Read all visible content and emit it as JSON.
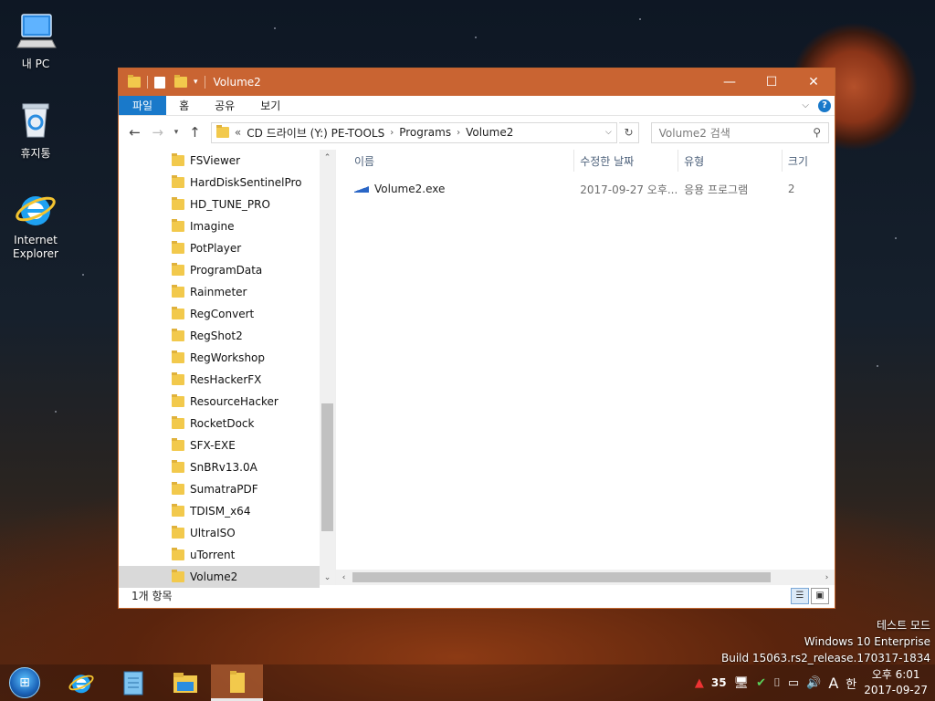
{
  "desktop": {
    "icons": [
      {
        "label": "내 PC",
        "icon": "computer-icon"
      },
      {
        "label": "휴지통",
        "icon": "recycle-bin-icon"
      },
      {
        "label": "Internet\nExplorer",
        "icon": "internet-explorer-icon"
      }
    ]
  },
  "window": {
    "title": "Volume2",
    "controls": {
      "minimize": "—",
      "maximize": "☐",
      "close": "✕"
    },
    "ribbon_tabs": [
      "파일",
      "홈",
      "공유",
      "보기"
    ],
    "address": {
      "prefix": "«",
      "crumbs": [
        "CD 드라이브 (Y:) PE-TOOLS",
        "Programs",
        "Volume2"
      ]
    },
    "search_placeholder": "Volume2 검색",
    "nav_items": [
      "FSViewer",
      "HardDiskSentinelPro",
      "HD_TUNE_PRO",
      "Imagine",
      "PotPlayer",
      "ProgramData",
      "Rainmeter",
      "RegConvert",
      "RegShot2",
      "RegWorkshop",
      "ResHackerFX",
      "ResourceHacker",
      "RocketDock",
      "SFX-EXE",
      "SnBRv13.0A",
      "SumatraPDF",
      "TDISM_x64",
      "UltraISO",
      "uTorrent",
      "Volume2"
    ],
    "selected_nav": "Volume2",
    "columns": [
      "이름",
      "수정한 날짜",
      "유형",
      "크기"
    ],
    "files": [
      {
        "name": "Volume2.exe",
        "date": "2017-09-27 오후...",
        "type": "응용 프로그램",
        "size": "2"
      }
    ],
    "status": "1개 항목"
  },
  "watermark": {
    "line1": "테스트 모드",
    "line2": "Windows 10 Enterprise",
    "line3": "Build 15063.rs2_release.170317-1834"
  },
  "taskbar": {
    "apps": [
      "internet-explorer-icon",
      "notepad-icon",
      "file-explorer-icon",
      "folder-icon"
    ],
    "tray": {
      "temp": "35",
      "ime": "A",
      "lang": "한"
    },
    "clock": {
      "time": "오후 6:01",
      "date": "2017-09-27"
    }
  },
  "colors": {
    "titlebar": "#c96432",
    "file_tab": "#1979ca",
    "accent": "#1979ca"
  }
}
